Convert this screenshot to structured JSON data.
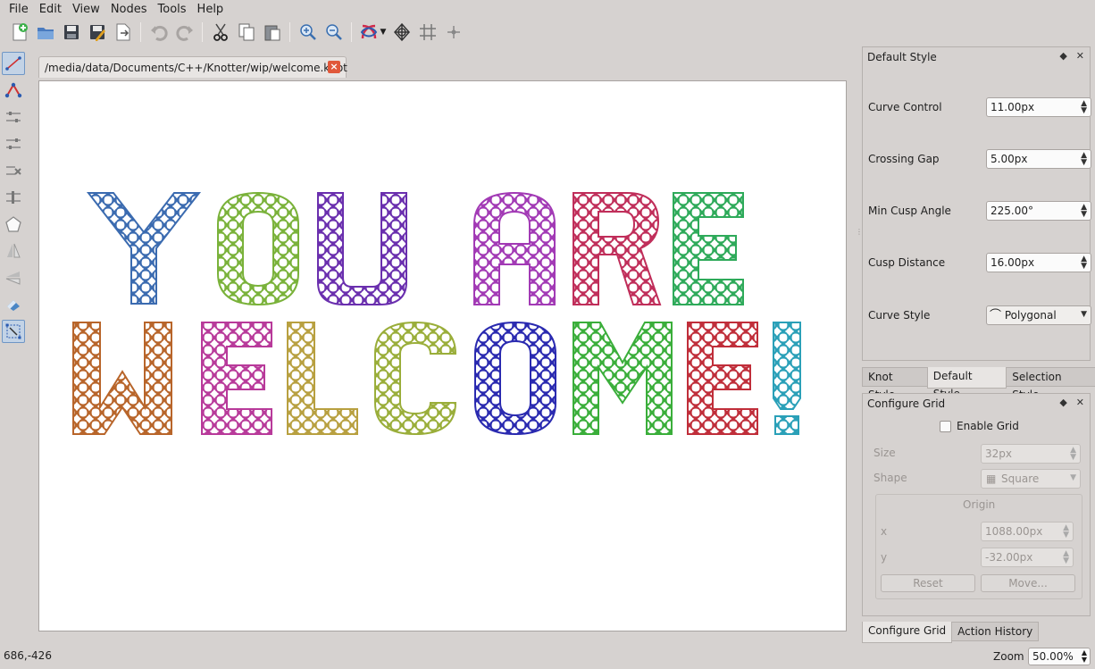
{
  "menu": [
    {
      "label": "File",
      "accel": "F",
      "rest": "ile"
    },
    {
      "label": "Edit",
      "accel": "E",
      "rest": "dit"
    },
    {
      "label": "View",
      "accel": "V",
      "rest": "iew"
    },
    {
      "label": "Nodes",
      "accel": "o",
      "pre": "N",
      "rest": "des"
    },
    {
      "label": "Tools",
      "accel": "T",
      "rest": "ools"
    },
    {
      "label": "Help",
      "accel": "H",
      "rest": "elp"
    }
  ],
  "toolbar": {
    "icons": [
      "new-file-icon",
      "open-file-icon",
      "save-icon",
      "save-as-icon",
      "export-icon",
      "undo-icon",
      "redo-icon",
      "cut-icon",
      "copy-icon",
      "paste-icon",
      "zoom-in-icon",
      "zoom-out-icon",
      "knot-style-icon",
      "celtic-knot-icon",
      "grid-icon",
      "snap-icon"
    ]
  },
  "left_tools": {
    "icons": [
      "edit-line-icon",
      "edit-graph-icon",
      "node-align-icon",
      "node-distribute-icon",
      "node-remove-icon",
      "node-arrange-icon",
      "polygon-icon",
      "mirror-horizontal-icon",
      "mirror-vertical-icon",
      "erase-icon",
      "select-icon"
    ]
  },
  "document": {
    "path": "/media/data/Documents/C++/Knotter/wip/welcome.knot",
    "close_symbol": "×"
  },
  "canvas": {
    "line1": [
      "Y",
      "O",
      "U",
      " ",
      "A",
      "R",
      "E"
    ],
    "line2": [
      "W",
      "E",
      "L",
      "C",
      "O",
      "M",
      "E",
      "!"
    ],
    "colors": {
      "Y": "#3b6bb0",
      "O1": "#7ab23a",
      "U": "#6a2fae",
      "A": "#a23ab5",
      "R": "#c02e5a",
      "E1": "#2eaa5a",
      "W": "#b8652a",
      "E2": "#b83a9a",
      "L": "#b8a040",
      "C": "#9aae3a",
      "O2": "#2a2ab0",
      "M": "#3aae3a",
      "E3": "#c02e3a",
      "EXCL": "#2aa0b8"
    }
  },
  "default_style": {
    "title": "Default Style",
    "fields": [
      {
        "label": "Curve Control",
        "value": "11.00px"
      },
      {
        "label": "Crossing Gap",
        "value": "5.00px"
      },
      {
        "label": "Min Cusp Angle",
        "value": "225.00°"
      },
      {
        "label": "Cusp Distance",
        "value": "16.00px"
      }
    ],
    "curve_style_label": "Curve Style",
    "curve_style_value": "Polygonal"
  },
  "style_tabs": [
    "Knot Style",
    "Default Style",
    "Selection Style"
  ],
  "configure_grid": {
    "title": "Configure Grid",
    "enable_label": "Enable Grid",
    "size_label": "Size",
    "size_value": "32px",
    "shape_label": "Shape",
    "shape_value": "Square",
    "origin_label": "Origin",
    "x_label": "x",
    "x_value": "1088.00px",
    "y_label": "y",
    "y_value": "-32.00px",
    "reset_label": "Reset",
    "move_label": "Move..."
  },
  "bottom_tabs": [
    "Configure Grid",
    "Action History"
  ],
  "status": {
    "coords": "686,-426",
    "zoom_label": "Zoom",
    "zoom_value": "50.00%"
  }
}
